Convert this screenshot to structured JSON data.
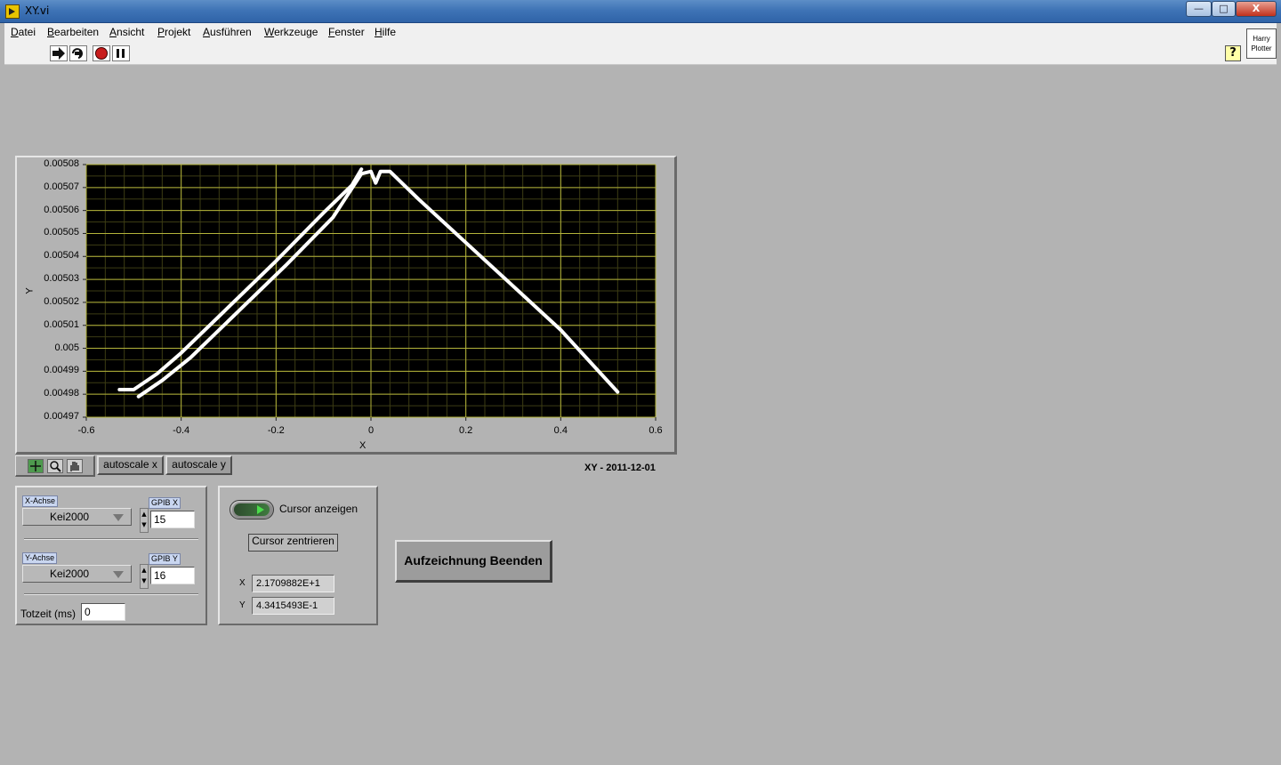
{
  "window": {
    "title": "XY.vi",
    "min_label": "—",
    "max_label": "□",
    "close_label": "X"
  },
  "menu": [
    "Datei",
    "Bearbeiten",
    "Ansicht",
    "Projekt",
    "Ausführen",
    "Werkzeuge",
    "Fenster",
    "Hilfe"
  ],
  "toolbar": {
    "icons": [
      "run-arrow-icon",
      "run-continuously-icon",
      "abort-icon",
      "pause-icon"
    ],
    "help_label": "?",
    "vi_icon_line1": "Harry",
    "vi_icon_line2": "Plotter"
  },
  "graph": {
    "caption": "XY - 2011-12-01",
    "autoscale_x": "autoscale x",
    "autoscale_y": "autoscale y",
    "palette_icons": [
      "cursor-crosshair-icon",
      "zoom-icon",
      "pan-hand-icon"
    ],
    "colors": {
      "plot_bg": "#000000",
      "major_grid": "#b3b33a",
      "minor_grid": "#3c3c14",
      "trace": "#ffffff"
    }
  },
  "chart_data": {
    "type": "scatter",
    "xlabel": "X",
    "ylabel": "Y",
    "xlim": [
      -0.6,
      0.6
    ],
    "ylim": [
      0.00497,
      0.00508
    ],
    "x_ticks": [
      "-0.6",
      "-0.4",
      "-0.2",
      "0",
      "0.2",
      "0.4",
      "0.6"
    ],
    "y_ticks": [
      "0.00508",
      "0.00507",
      "0.00506",
      "0.00505",
      "0.00504",
      "0.00503",
      "0.00502",
      "0.00501",
      "0.005",
      "0.00499",
      "0.00498",
      "0.00497"
    ],
    "grid": true,
    "series": [
      {
        "x": [
          -0.53,
          -0.5,
          -0.45,
          -0.4,
          -0.3,
          -0.2,
          -0.1,
          -0.04,
          -0.02
        ],
        "y": [
          0.004982,
          0.004982,
          0.004989,
          0.004998,
          0.005018,
          0.005038,
          0.005059,
          0.005071,
          0.005078
        ]
      },
      {
        "x": [
          -0.49,
          -0.44,
          -0.38,
          -0.28,
          -0.18,
          -0.08,
          -0.02,
          0.0,
          0.01,
          0.02,
          0.04,
          0.1,
          0.2,
          0.3,
          0.4,
          0.52
        ],
        "y": [
          0.004979,
          0.004986,
          0.004996,
          0.005016,
          0.005036,
          0.005057,
          0.005076,
          0.005077,
          0.005072,
          0.005077,
          0.005077,
          0.005065,
          0.005046,
          0.005027,
          0.005008,
          0.004981
        ]
      }
    ]
  },
  "source_panel": {
    "x_axis_label": "X-Achse",
    "x_axis_value": "Kei2000",
    "gpib_x_label": "GPIB X",
    "gpib_x_value": "15",
    "y_axis_label": "Y-Achse",
    "y_axis_value": "Kei2000",
    "gpib_y_label": "GPIB Y",
    "gpib_y_value": "16",
    "deadtime_label": "Totzeit (ms)",
    "deadtime_value": "0"
  },
  "cursor_panel": {
    "show_cursor_label": "Cursor anzeigen",
    "center_cursor_label": "Cursor zentrieren",
    "x_label": "X",
    "x_value": "2.1709882E+1",
    "y_label": "Y",
    "y_value": "4.3415493E-1"
  },
  "stop_button_label": "Aufzeichnung Beenden"
}
